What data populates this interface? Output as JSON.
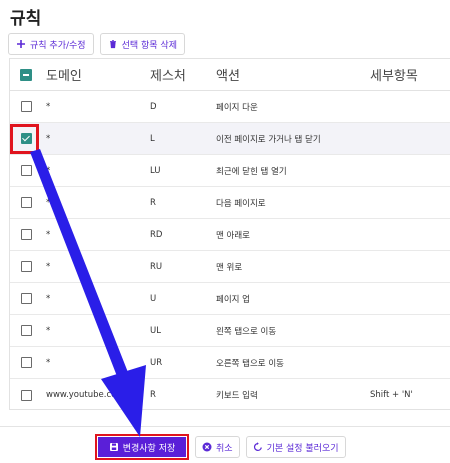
{
  "title": "규칙",
  "toolbar": {
    "add_label": "규칙 추가/수정",
    "delete_label": "선택 항목 삭제"
  },
  "table": {
    "headers": {
      "domain": "도메인",
      "gesture": "제스처",
      "action": "액션",
      "detail": "세부항목"
    },
    "rows": [
      {
        "domain": "*",
        "gesture": "D",
        "action": "페이지 다운",
        "detail": "",
        "checked": false
      },
      {
        "domain": "*",
        "gesture": "L",
        "action": "이전 페이지로 가거나 탭 닫기",
        "detail": "",
        "checked": true
      },
      {
        "domain": "*",
        "gesture": "LU",
        "action": "최근에 닫힌 탭 열기",
        "detail": "",
        "checked": false
      },
      {
        "domain": "*",
        "gesture": "R",
        "action": "다음 페이지로",
        "detail": "",
        "checked": false
      },
      {
        "domain": "*",
        "gesture": "RD",
        "action": "맨 아래로",
        "detail": "",
        "checked": false
      },
      {
        "domain": "*",
        "gesture": "RU",
        "action": "맨 위로",
        "detail": "",
        "checked": false
      },
      {
        "domain": "*",
        "gesture": "U",
        "action": "페이지 업",
        "detail": "",
        "checked": false
      },
      {
        "domain": "*",
        "gesture": "UL",
        "action": "왼쪽 탭으로 이동",
        "detail": "",
        "checked": false
      },
      {
        "domain": "*",
        "gesture": "UR",
        "action": "오른쪽 탭으로 이동",
        "detail": "",
        "checked": false
      },
      {
        "domain": "www.youtube.com",
        "gesture": "R",
        "action": "키보드 입력",
        "detail": "Shift + 'N'",
        "checked": false
      }
    ]
  },
  "footer": {
    "save_label": "변경사항 저장",
    "cancel_label": "취소",
    "reset_label": "기본 설정 불러오기"
  },
  "colors": {
    "accent": "#5a1fd8",
    "check": "#2e8f86",
    "highlight": "#e0141e",
    "arrow": "#2a1ee8"
  }
}
